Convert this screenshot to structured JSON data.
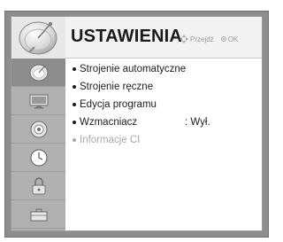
{
  "header": {
    "title": "USTAWIENIA",
    "hint_move": "Przejdź",
    "hint_ok": "OK"
  },
  "sidebar": {
    "items": [
      {
        "icon": "satellite-dish-icon",
        "active": true
      },
      {
        "icon": "picture-monitor-icon",
        "active": false
      },
      {
        "icon": "audio-speaker-icon",
        "active": false
      },
      {
        "icon": "clock-icon",
        "active": false
      },
      {
        "icon": "lock-icon",
        "active": false
      },
      {
        "icon": "options-toolbox-icon",
        "active": false
      }
    ]
  },
  "menu": {
    "items": [
      {
        "label": "Strojenie automatyczne",
        "value": "",
        "enabled": true
      },
      {
        "label": "Strojenie ręczne",
        "value": "",
        "enabled": true
      },
      {
        "label": "Edycja programu",
        "value": "",
        "enabled": true
      },
      {
        "label": "Wzmacniacz",
        "value": ": Wył.",
        "enabled": true
      },
      {
        "label": "Informacje CI",
        "value": "",
        "enabled": false
      }
    ]
  },
  "colors": {
    "frame": "#8e8e8e",
    "sidebar": "#b0b0b0",
    "sidebar_active": "#8d8d8d",
    "content_bg": "#ffffff",
    "disabled_text": "#a8a8a8"
  }
}
